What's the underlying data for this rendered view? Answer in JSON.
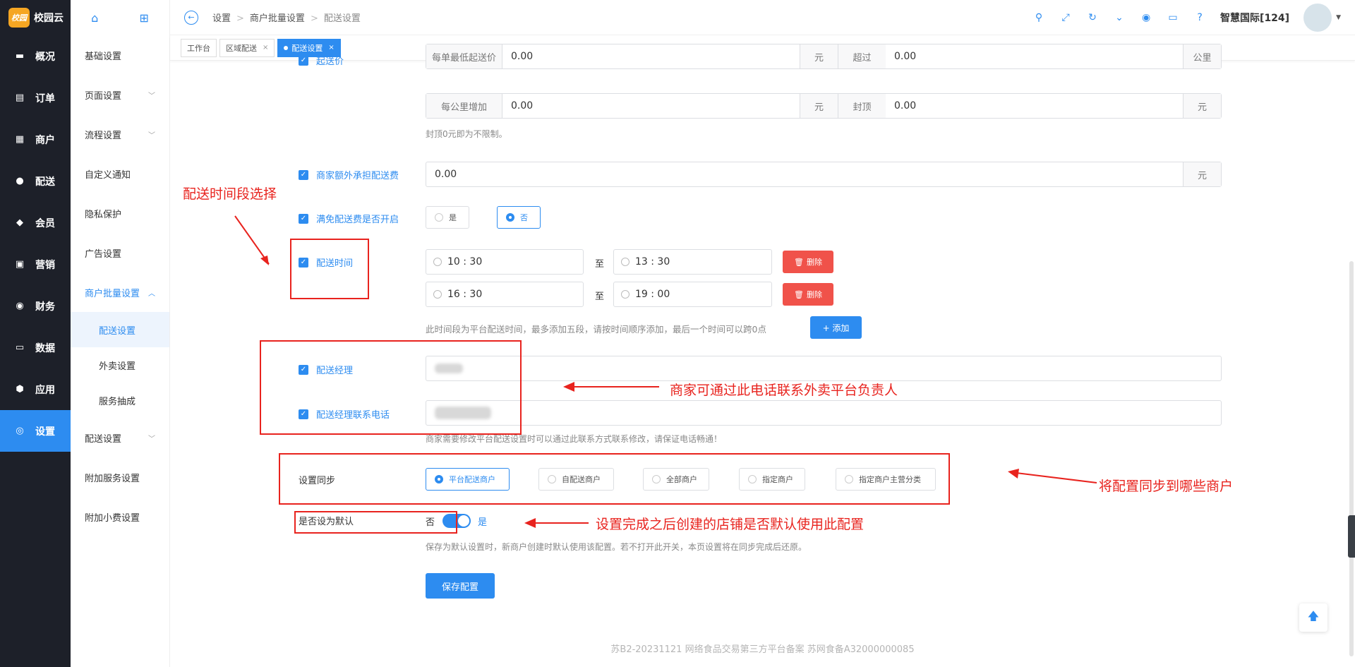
{
  "brand": {
    "badge": "校园",
    "name": "校园云"
  },
  "nav": [
    {
      "label": "概况",
      "icon": "monitor-icon"
    },
    {
      "label": "订单",
      "icon": "order-icon"
    },
    {
      "label": "商户",
      "icon": "store-icon"
    },
    {
      "label": "配送",
      "icon": "delivery-icon"
    },
    {
      "label": "会员",
      "icon": "member-icon"
    },
    {
      "label": "营销",
      "icon": "marketing-icon"
    },
    {
      "label": "财务",
      "icon": "finance-icon"
    },
    {
      "label": "数据",
      "icon": "data-icon"
    },
    {
      "label": "应用",
      "icon": "app-icon"
    },
    {
      "label": "设置",
      "icon": "settings-icon"
    }
  ],
  "subnav": {
    "items": [
      "基础设置",
      "页面设置",
      "流程设置",
      "自定义通知",
      "隐私保护",
      "广告设置",
      "商户批量设置"
    ],
    "children": [
      "配送设置",
      "外卖设置",
      "服务抽成"
    ],
    "after": [
      "配送设置",
      "附加服务设置",
      "附加小费设置"
    ]
  },
  "breadcrumb": [
    "设置",
    "商户批量设置",
    "配送设置"
  ],
  "header": {
    "user": "智慧国际[124]"
  },
  "tabs": [
    "工作台",
    "区域配送",
    "配送设置"
  ],
  "form": {
    "start_price": {
      "label": "起送价",
      "addon1": "每单最低起送价",
      "value1": "0.00",
      "unit1": "元",
      "addon2": "超过",
      "value2": "0.00",
      "unit2": "公里"
    },
    "per_km": {
      "addon1": "每公里增加",
      "value1": "0.00",
      "unit1": "元",
      "addon2": "封顶",
      "value2": "0.00",
      "unit2": "元"
    },
    "cap_hint": "封顶0元即为不限制。",
    "merchant_extra": {
      "label": "商家额外承担配送费",
      "value": "0.00",
      "unit": "元"
    },
    "free_delivery": {
      "label": "满免配送费是否开启",
      "yes": "是",
      "no": "否"
    },
    "delivery_time": {
      "label": "配送时间",
      "to": "至",
      "slots": [
        {
          "start": "10 : 30",
          "end": "13 : 30"
        },
        {
          "start": "16 : 30",
          "end": "19 : 00"
        }
      ],
      "delete": "删除",
      "hint": "此时间段为平台配送时间，最多添加五段，请按时间顺序添加，最后一个时间可以跨0点",
      "add": "+ 添加"
    },
    "manager": {
      "label": "配送经理"
    },
    "manager_phone": {
      "label": "配送经理联系电话"
    },
    "manager_hint": "商家需要修改平台配送设置时可以通过此联系方式联系修改，请保证电话畅通！",
    "sync": {
      "label": "设置同步",
      "options": [
        "平台配送商户",
        "自配送商户",
        "全部商户",
        "指定商户",
        "指定商户主营分类"
      ]
    },
    "default": {
      "label": "是否设为默认",
      "off": "否",
      "on": "是",
      "hint": "保存为默认设置时，新商户创建时默认使用该配置。若不打开此开关，本页设置将在同步完成后还原。"
    },
    "save": "保存配置"
  },
  "annotations": {
    "time_select": "配送时间段选择",
    "contact": "商家可通过此电话联系外卖平台负责人",
    "sync": "将配置同步到哪些商户",
    "default": "设置完成之后创建的店铺是否默认使用此配置"
  },
  "footer": "苏B2-20231121  网络食品交易第三方平台备案 苏网食备A32000000085"
}
